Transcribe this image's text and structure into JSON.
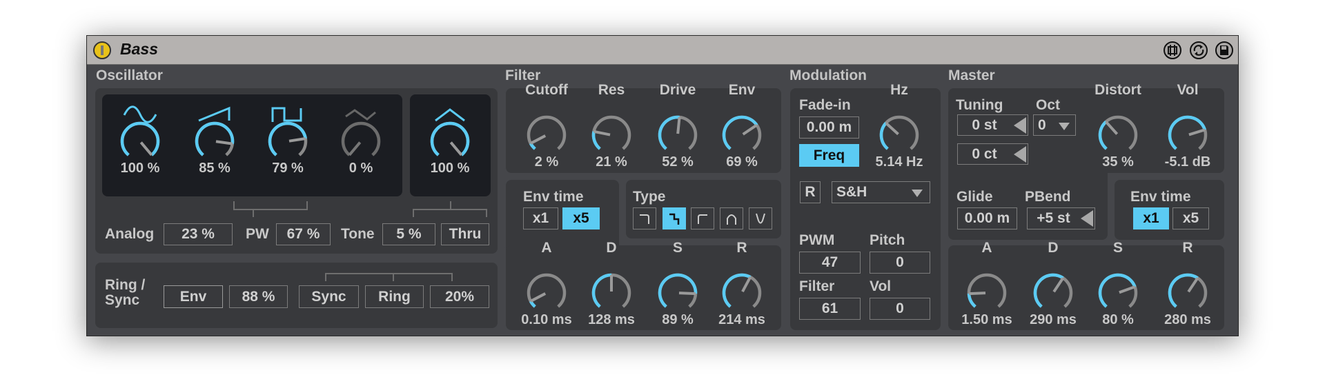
{
  "title": "Bass",
  "colors": {
    "accent": "#5bcbf3",
    "track": "#8a8a8a",
    "inactive": "#6c6c6c"
  },
  "titlebar_icons": [
    "hot-swap-icon",
    "refresh-icon",
    "save-icon"
  ],
  "oscillator": {
    "heading": "Oscillator",
    "knobs": [
      {
        "wave": "sine",
        "value": "100 %",
        "fill": 1.0,
        "active": true
      },
      {
        "wave": "saw",
        "value": "85 %",
        "fill": 0.85,
        "active": true
      },
      {
        "wave": "square",
        "value": "79 %",
        "fill": 0.79,
        "active": true
      },
      {
        "wave": "noise",
        "value": "0 %",
        "fill": 0.0,
        "active": false
      },
      {
        "wave": "sub",
        "value": "100 %",
        "fill": 1.0,
        "active": true
      }
    ],
    "analog_label": "Analog",
    "analog_value": "23 %",
    "pw_label": "PW",
    "pw_value": "67 %",
    "tone_label": "Tone",
    "tone_value": "5 %",
    "thru_label": "Thru",
    "ring_sync_label_1": "Ring /",
    "ring_sync_label_2": "Sync",
    "env_label": "Env",
    "env_amount": "88 %",
    "sync_label": "Sync",
    "ring_label": "Ring",
    "ring_value": "20%"
  },
  "filter": {
    "heading": "Filter",
    "knobs": [
      {
        "label": "Cutoff",
        "value": "2 %",
        "fill": 0.08
      },
      {
        "label": "Res",
        "value": "21 %",
        "fill": 0.22
      },
      {
        "label": "Drive",
        "value": "52 %",
        "fill": 0.52
      },
      {
        "label": "Env",
        "value": "69 %",
        "fill": 0.7
      }
    ],
    "env_time_label": "Env time",
    "env_x1": "x1",
    "env_x5": "x5",
    "type_label": "Type",
    "types": [
      "lowpass-icon",
      "lowpass-steep-icon",
      "highpass-icon",
      "bandpass-icon",
      "notch-icon"
    ],
    "selected_type": 1,
    "adsr": [
      {
        "label": "A",
        "value": "0.10 ms",
        "fill": 0.08
      },
      {
        "label": "D",
        "value": "128 ms",
        "fill": 0.5
      },
      {
        "label": "S",
        "value": "89 %",
        "fill": 0.83
      },
      {
        "label": "R",
        "value": "214 ms",
        "fill": 0.6
      }
    ]
  },
  "modulation": {
    "heading": "Modulation",
    "fade_in_label": "Fade-in",
    "fade_in_value": "0.00 m",
    "freq_label": "Freq",
    "hz_label": "Hz",
    "hz_value": "5.14 Hz",
    "hz_fill": 0.33,
    "retrigger_label": "R",
    "shape_value": "S&H",
    "pwm_label": "PWM",
    "pwm_value": "47",
    "pitch_label": "Pitch",
    "pitch_value": "0",
    "filter_label": "Filter",
    "filter_value": "61",
    "vol_label": "Vol",
    "vol_value": "0"
  },
  "master": {
    "heading": "Master",
    "tuning_label": "Tuning",
    "tuning_st": "0 st",
    "tuning_ct": "0 ct",
    "oct_label": "Oct",
    "oct_value": "0",
    "distort_label": "Distort",
    "distort_value": "35 %",
    "distort_fill": 0.35,
    "vol_label": "Vol",
    "vol_value": "-5.1 dB",
    "vol_fill": 0.76,
    "glide_label": "Glide",
    "glide_value": "0.00 m",
    "pbend_label": "PBend",
    "pbend_value": "+5 st",
    "env_time_label": "Env time",
    "env_x1": "x1",
    "env_x5": "x5",
    "adsr": [
      {
        "label": "A",
        "value": "1.50 ms",
        "fill": 0.17
      },
      {
        "label": "D",
        "value": "290 ms",
        "fill": 0.62
      },
      {
        "label": "S",
        "value": "80 %",
        "fill": 0.75
      },
      {
        "label": "R",
        "value": "280 ms",
        "fill": 0.62
      }
    ]
  }
}
